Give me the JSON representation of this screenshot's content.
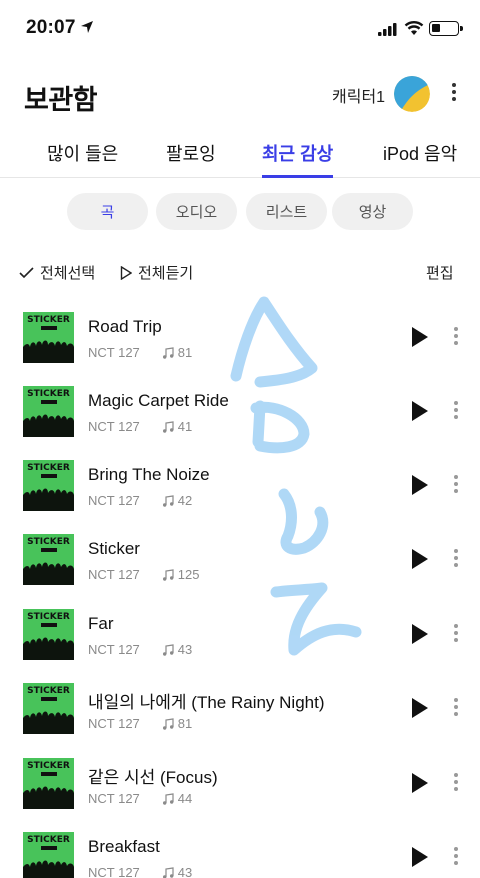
{
  "status_bar": {
    "time": "20:07"
  },
  "header": {
    "title": "보관함",
    "character_name": "캐릭터1"
  },
  "tabs": [
    {
      "label": "많이 들은",
      "active": false
    },
    {
      "label": "팔로잉",
      "active": false
    },
    {
      "label": "최근 감상",
      "active": true
    },
    {
      "label": "iPod 음악",
      "active": false
    }
  ],
  "filters": [
    {
      "label": "곡",
      "active": true
    },
    {
      "label": "오디오",
      "active": false
    },
    {
      "label": "리스트",
      "active": false
    },
    {
      "label": "영상",
      "active": false
    }
  ],
  "actions": {
    "select_all": "전체선택",
    "play_all": "전체듣기",
    "edit": "편집"
  },
  "album_art_text": "STICKER",
  "songs": [
    {
      "title": "Road Trip",
      "artist": "NCT 127",
      "plays": "81"
    },
    {
      "title": "Magic Carpet Ride",
      "artist": "NCT 127",
      "plays": "41"
    },
    {
      "title": "Bring The Noize",
      "artist": "NCT 127",
      "plays": "42"
    },
    {
      "title": "Sticker",
      "artist": "NCT 127",
      "plays": "125"
    },
    {
      "title": "Far",
      "artist": "NCT 127",
      "plays": "43"
    },
    {
      "title": "내일의 나에게 (The Rainy Night)",
      "artist": "NCT 127",
      "plays": "81"
    },
    {
      "title": "같은 시선 (Focus)",
      "artist": "NCT 127",
      "plays": "44"
    },
    {
      "title": "Breakfast",
      "artist": "NCT 127",
      "plays": "43"
    }
  ],
  "colors": {
    "accent": "#3a3ee6",
    "album_green": "#48c35a",
    "doodle_blue": "#9fd0f5"
  }
}
